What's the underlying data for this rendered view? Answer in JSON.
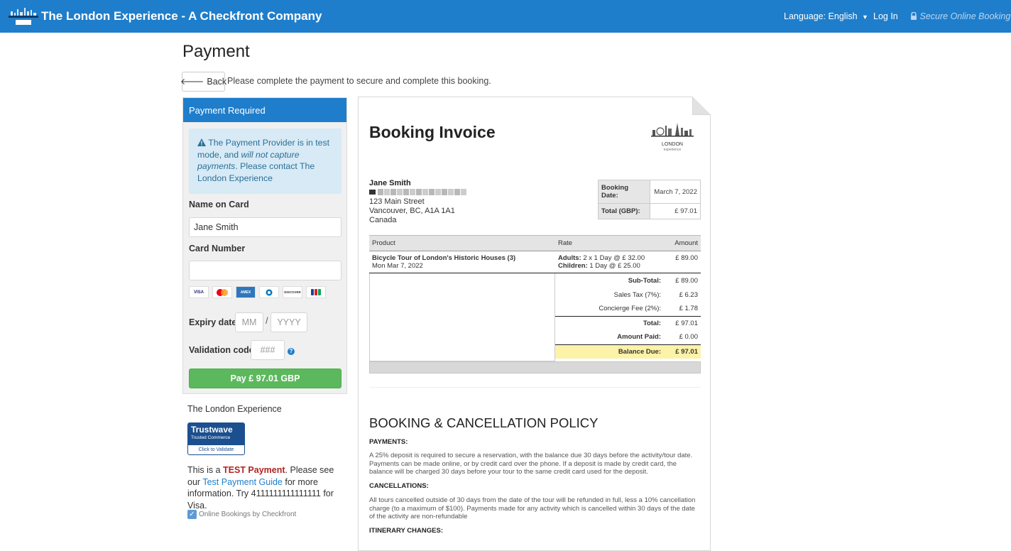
{
  "header": {
    "brand_title": "The London Experience - A Checkfront Company",
    "language_label": "Language: English",
    "login_label": "Log In",
    "secure_label": "Secure Online Booking"
  },
  "page": {
    "title": "Payment",
    "back_label": "Back",
    "intro": "Please complete the payment to secure and complete this booking."
  },
  "payment": {
    "panel_title": "Payment Required",
    "alert_pre": "The Payment Provider is in test mode, and ",
    "alert_em": "will not capture payments",
    "alert_post": ". Please contact The London Experience",
    "name_label": "Name on Card",
    "name_value": "Jane Smith",
    "card_label": "Card Number",
    "card_value": "",
    "card_brands": [
      "VISA",
      "MC",
      "AMEX",
      "DC",
      "DISCOVER",
      "JCB"
    ],
    "expiry_label": "Expiry date",
    "expiry_month_placeholder": "MM",
    "expiry_year_placeholder": "YYYY",
    "expiry_separator": "/",
    "cvv_label": "Validation code",
    "cvv_placeholder": "###",
    "pay_button": "Pay £ 97.01 GBP"
  },
  "sidebar": {
    "company": "The London Experience",
    "trustwave_name": "Trustwave",
    "trustwave_sub": "Trusted Commerce",
    "trustwave_validate": "Click to Validate",
    "test_pre": "This is a ",
    "test_word": "TEST Payment",
    "test_mid": ". Please see our ",
    "test_link": "Test Payment Guide",
    "test_post": " for more information. Try 4111111111111111 for Visa.",
    "checkfront_label": "Online Bookings by Checkfront"
  },
  "invoice": {
    "title": "Booking Invoice",
    "logo_text": "LONDON",
    "logo_subtext": "experience",
    "customer_name": "Jane Smith",
    "address_lines": [
      "123 Main Street",
      "Vancouver, BC, A1A 1A1",
      "Canada"
    ],
    "booking_date_label": "Booking Date:",
    "booking_date": "March 7, 2022",
    "total_label": "Total (GBP):",
    "total_value": "£ 97.01",
    "columns": {
      "product": "Product",
      "rate": "Rate",
      "amount": "Amount"
    },
    "item": {
      "name": "Bicycle Tour of London's Historic Houses (3)",
      "date": "Mon Mar 7, 2022",
      "adults_label": "Adults:",
      "adults_rate": "2 x 1 Day @ £ 32.00",
      "children_label": "Children:",
      "children_rate": "1 Day @ £ 25.00",
      "amount": "£ 89.00"
    },
    "totals": [
      {
        "label": "Sub-Total:",
        "value": "£ 89.00"
      },
      {
        "label": "Sales Tax (7%):",
        "value": "£ 6.23"
      },
      {
        "label": "Concierge Fee (2%):",
        "value": "£ 1.78"
      },
      {
        "label": "Total:",
        "value": "£ 97.01"
      },
      {
        "label": "Amount Paid:",
        "value": "£ 0.00"
      },
      {
        "label": "Balance Due:",
        "value": "£ 97.01"
      }
    ]
  },
  "policy": {
    "title": "BOOKING & CANCELLATION POLICY",
    "payments_heading": "PAYMENTS:",
    "payments_text": "A 25% deposit is required to secure a reservation, with the balance due 30 days before the activity/tour date. Payments can be made online, or by credit card over the phone. If a deposit is made by credit card, the balance will be charged 30 days before your tour to the same credit card used for the deposit.",
    "cancellations_heading": "CANCELLATIONS:",
    "cancellations_text": "All tours cancelled outside of 30 days from the date of the tour will be refunded in full, less a 10% cancellation charge (to a maximum of $100). Payments made for any activity which is cancelled within 30 days of the date of the activity are non-refundable",
    "itinerary_heading": "ITINERARY CHANGES:"
  }
}
